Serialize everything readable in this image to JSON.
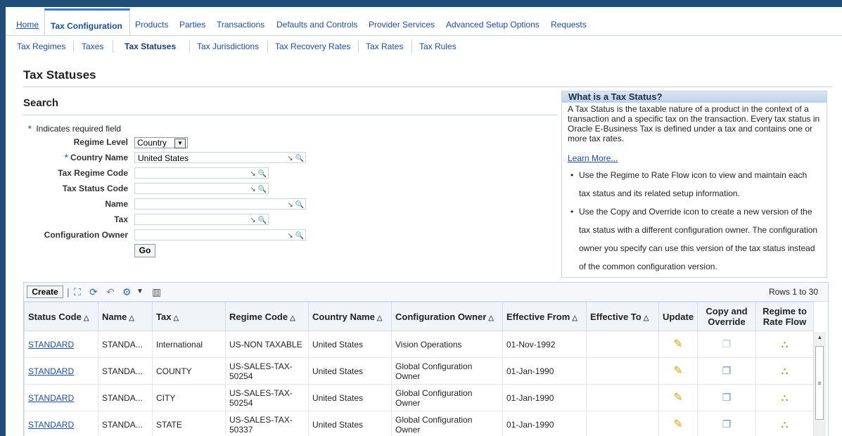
{
  "tabs": {
    "home": "Home",
    "items": [
      "Tax Configuration",
      "Products",
      "Parties",
      "Transactions",
      "Defaults and Controls",
      "Provider Services",
      "Advanced Setup Options",
      "Requests"
    ]
  },
  "subtabs": [
    "Tax Regimes",
    "Taxes",
    "Tax Statuses",
    "Tax Jurisdictions",
    "Tax Recovery Rates",
    "Tax Rates",
    "Tax Rules"
  ],
  "page": {
    "title": "Tax Statuses",
    "search_title": "Search",
    "required_note": "Indicates required field",
    "required_star": "*"
  },
  "form": {
    "regime_level_label": "Regime Level",
    "regime_level_value": "Country",
    "country_name_label": "Country Name",
    "country_name_value": "United States",
    "tax_regime_code_label": "Tax Regime Code",
    "tax_status_code_label": "Tax Status Code",
    "name_label": "Name",
    "tax_label": "Tax",
    "config_owner_label": "Configuration Owner",
    "go_label": "Go"
  },
  "info": {
    "title": "What is a Tax Status?",
    "description": "A Tax Status is the taxable nature of a product in the context of a transaction and a specific tax on the transaction. Every tax status in Oracle E-Business Tax is defined under a tax and contains one or more tax rates.",
    "learn_more": "Learn More...",
    "bullets": [
      "Use the Regime to Rate Flow icon to view and maintain each tax status and its related setup information.",
      "Use the Copy and Override icon to create a new version of the tax status with a different configuration owner. The configuration owner you specify can use this version of the tax status instead of the common configuration version."
    ]
  },
  "table": {
    "create_label": "Create",
    "rows_info": "Rows 1 to 30",
    "columns": [
      "Status Code",
      "Name",
      "Tax",
      "Regime Code",
      "Country Name",
      "Configuration Owner",
      "Effective From",
      "Effective To",
      "Update",
      "Copy and Override",
      "Regime to Rate Flow"
    ],
    "rows": [
      {
        "status_code": "STANDARD",
        "name": "STANDA...",
        "tax": "International",
        "regime_code": "US-NON TAXABLE",
        "country": "United States",
        "owner": "Vision Operations",
        "eff_from": "01-Nov-1992",
        "eff_to": "",
        "copy_disabled": true
      },
      {
        "status_code": "STANDARD",
        "name": "STANDA...",
        "tax": "COUNTY",
        "regime_code": "US-SALES-TAX-50254",
        "country": "United States",
        "owner": "Global Configuration Owner",
        "eff_from": "01-Jan-1990",
        "eff_to": "",
        "copy_disabled": false
      },
      {
        "status_code": "STANDARD",
        "name": "STANDA...",
        "tax": "CITY",
        "regime_code": "US-SALES-TAX-50254",
        "country": "United States",
        "owner": "Global Configuration Owner",
        "eff_from": "01-Jan-1990",
        "eff_to": "",
        "copy_disabled": false
      },
      {
        "status_code": "STANDARD",
        "name": "STANDA...",
        "tax": "STATE",
        "regime_code": "US-SALES-TAX-50337",
        "country": "United States",
        "owner": "Global Configuration Owner",
        "eff_from": "01-Jan-1990",
        "eff_to": "",
        "copy_disabled": false
      }
    ]
  },
  "icons": {
    "pencil": "pencil-icon",
    "copy": "copy-icon",
    "flow": "flow-icon",
    "sort": "sort-ascending-icon",
    "search": "search-icon"
  },
  "colors": {
    "link": "#1c4ea0",
    "accent": "#3a78c1",
    "border": "#c7d3df"
  }
}
